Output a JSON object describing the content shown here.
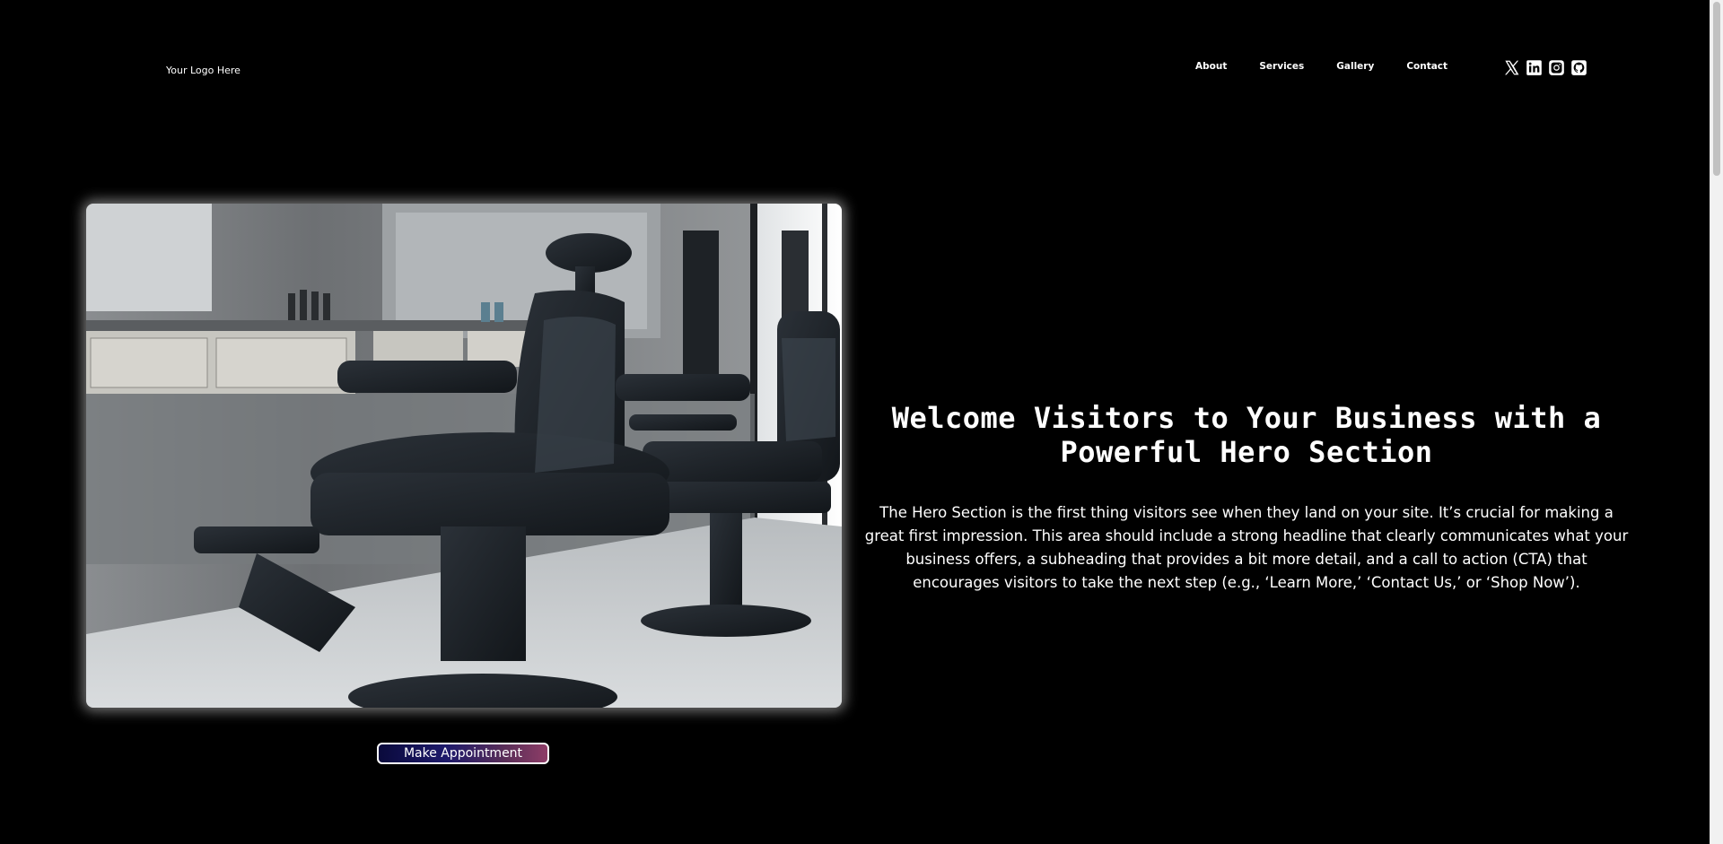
{
  "header": {
    "logo_text": "Your Logo Here",
    "nav": [
      {
        "label": "About"
      },
      {
        "label": "Services"
      },
      {
        "label": "Gallery"
      },
      {
        "label": "Contact"
      }
    ],
    "socials": [
      {
        "icon": "x-twitter-icon"
      },
      {
        "icon": "linkedin-icon"
      },
      {
        "icon": "instagram-icon"
      },
      {
        "icon": "github-icon"
      }
    ]
  },
  "hero": {
    "title": "Welcome Visitors to Your Business with a Powerful Hero Section",
    "subtitle": "The Hero Section is the first thing visitors see when they land on your site. It’s crucial for making a great first impression. This area should include a strong headline that clearly communicates what your business offers, a subheading that provides a bit more detail, and a call to action (CTA) that encourages visitors to take the next step (e.g., ‘Learn More,’ ‘Contact Us,’ or ‘Shop Now’).",
    "cta_label": "Make Appointment",
    "cta_gradient": [
      "#0a0a3c",
      "#1e1a6b",
      "#5a2e58",
      "#8e3d67"
    ]
  }
}
